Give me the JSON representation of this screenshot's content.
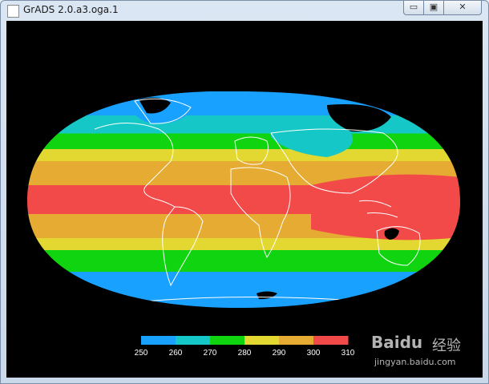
{
  "window": {
    "title": "GrADS 2.0.a3.oga.1",
    "controls": {
      "minimize": "▭",
      "maximize": "▣",
      "close": "✕"
    }
  },
  "colors": {
    "background": "#000000",
    "coastline": "#ffffff",
    "missing": "#000000"
  },
  "chart_data": {
    "type": "heatmap",
    "projection": "robinson",
    "colorbar": {
      "ticks": [
        "250",
        "260",
        "270",
        "280",
        "290",
        "300",
        "310"
      ],
      "bands": [
        {
          "min": 250,
          "max": 260,
          "color": "#19a1ff"
        },
        {
          "min": 260,
          "max": 270,
          "color": "#16c7c7"
        },
        {
          "min": 270,
          "max": 280,
          "color": "#0fd40f"
        },
        {
          "min": 280,
          "max": 290,
          "color": "#e3d832"
        },
        {
          "min": 290,
          "max": 300,
          "color": "#e6ab32"
        },
        {
          "min": 300,
          "max": 310,
          "color": "#f24949"
        }
      ]
    },
    "latitude_bands": [
      {
        "from": 90,
        "to": 70,
        "level": 250
      },
      {
        "from": 70,
        "to": 55,
        "level": 260
      },
      {
        "from": 55,
        "to": 42,
        "level": 270
      },
      {
        "from": 42,
        "to": 32,
        "level": 280
      },
      {
        "from": 32,
        "to": 12,
        "level": 290
      },
      {
        "from": 12,
        "to": -12,
        "level": 300
      },
      {
        "from": -12,
        "to": -32,
        "level": 290
      },
      {
        "from": -32,
        "to": -42,
        "level": 280
      },
      {
        "from": -42,
        "to": -60,
        "level": 270
      },
      {
        "from": -60,
        "to": -90,
        "level": 250
      }
    ]
  },
  "watermark": {
    "logo": "Baidu",
    "brand_cn": "经验",
    "url": "jingyan.baidu.com"
  }
}
